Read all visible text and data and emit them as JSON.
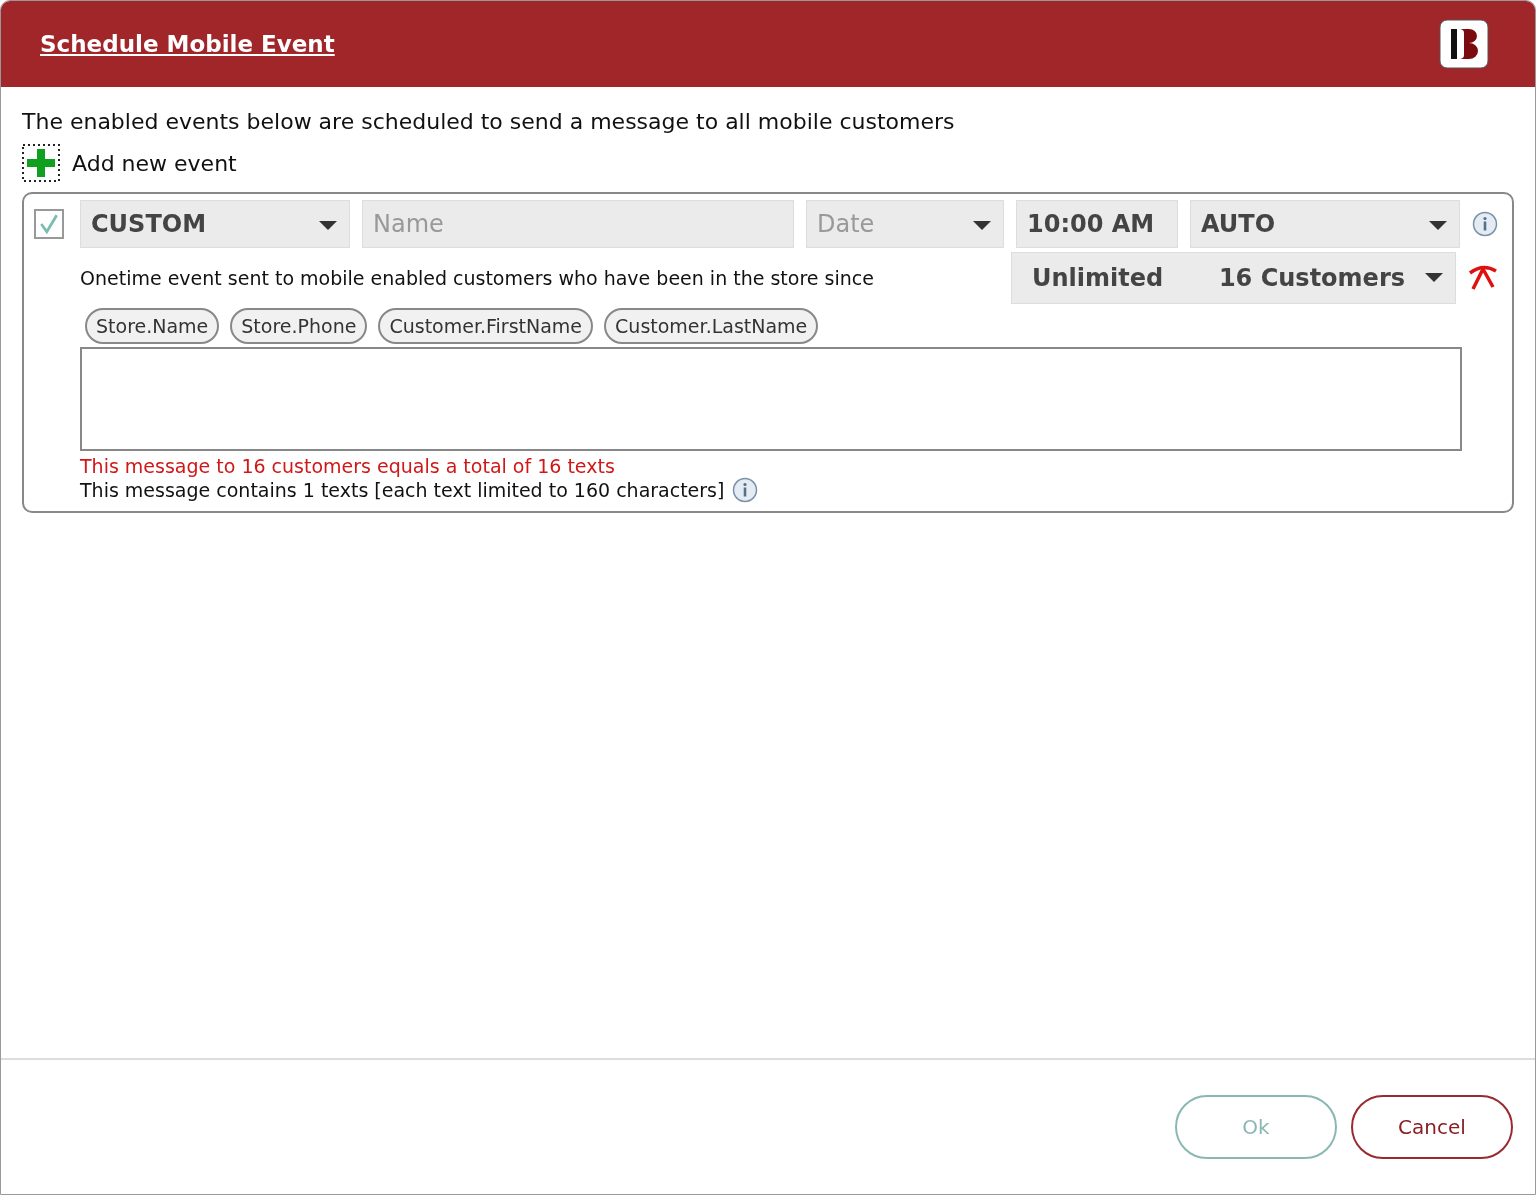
{
  "window": {
    "title": "Schedule Mobile Event"
  },
  "intro": "The enabled events below are scheduled to send a message to all mobile customers",
  "add_event": {
    "label": "Add new event"
  },
  "events": [
    {
      "enabled": true,
      "type": "CUSTOM",
      "name": {
        "placeholder": "Name"
      },
      "date": {
        "placeholder": "Date"
      },
      "time": "10:00 AM",
      "mode": "AUTO",
      "description": "Onetime event sent to mobile enabled customers who have been in the store since",
      "limit": "Unlimited",
      "audience": "16 Customers",
      "tokens": [
        "Store.Name",
        "Store.Phone",
        "Customer.FirstName",
        "Customer.LastName"
      ],
      "warning": "This message to 16 customers equals a total of 16 texts",
      "info": "This message contains 1 texts [each text limited to 160 characters]"
    }
  ],
  "buttons": [
    {
      "label": "Ok",
      "kind": "ok"
    },
    {
      "label": "Cancel",
      "kind": "cancel"
    }
  ]
}
